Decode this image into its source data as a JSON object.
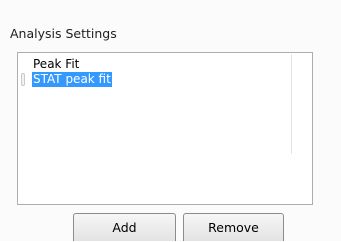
{
  "group": {
    "title": "Analysis Settings"
  },
  "list": {
    "items": [
      {
        "label": "Peak Fit",
        "selected": false
      },
      {
        "label": "STAT peak fit",
        "selected": true
      }
    ]
  },
  "buttons": {
    "add_label": "Add",
    "remove_label": "Remove"
  },
  "colors": {
    "selection": "#3399ff",
    "border": "#abadb3"
  }
}
